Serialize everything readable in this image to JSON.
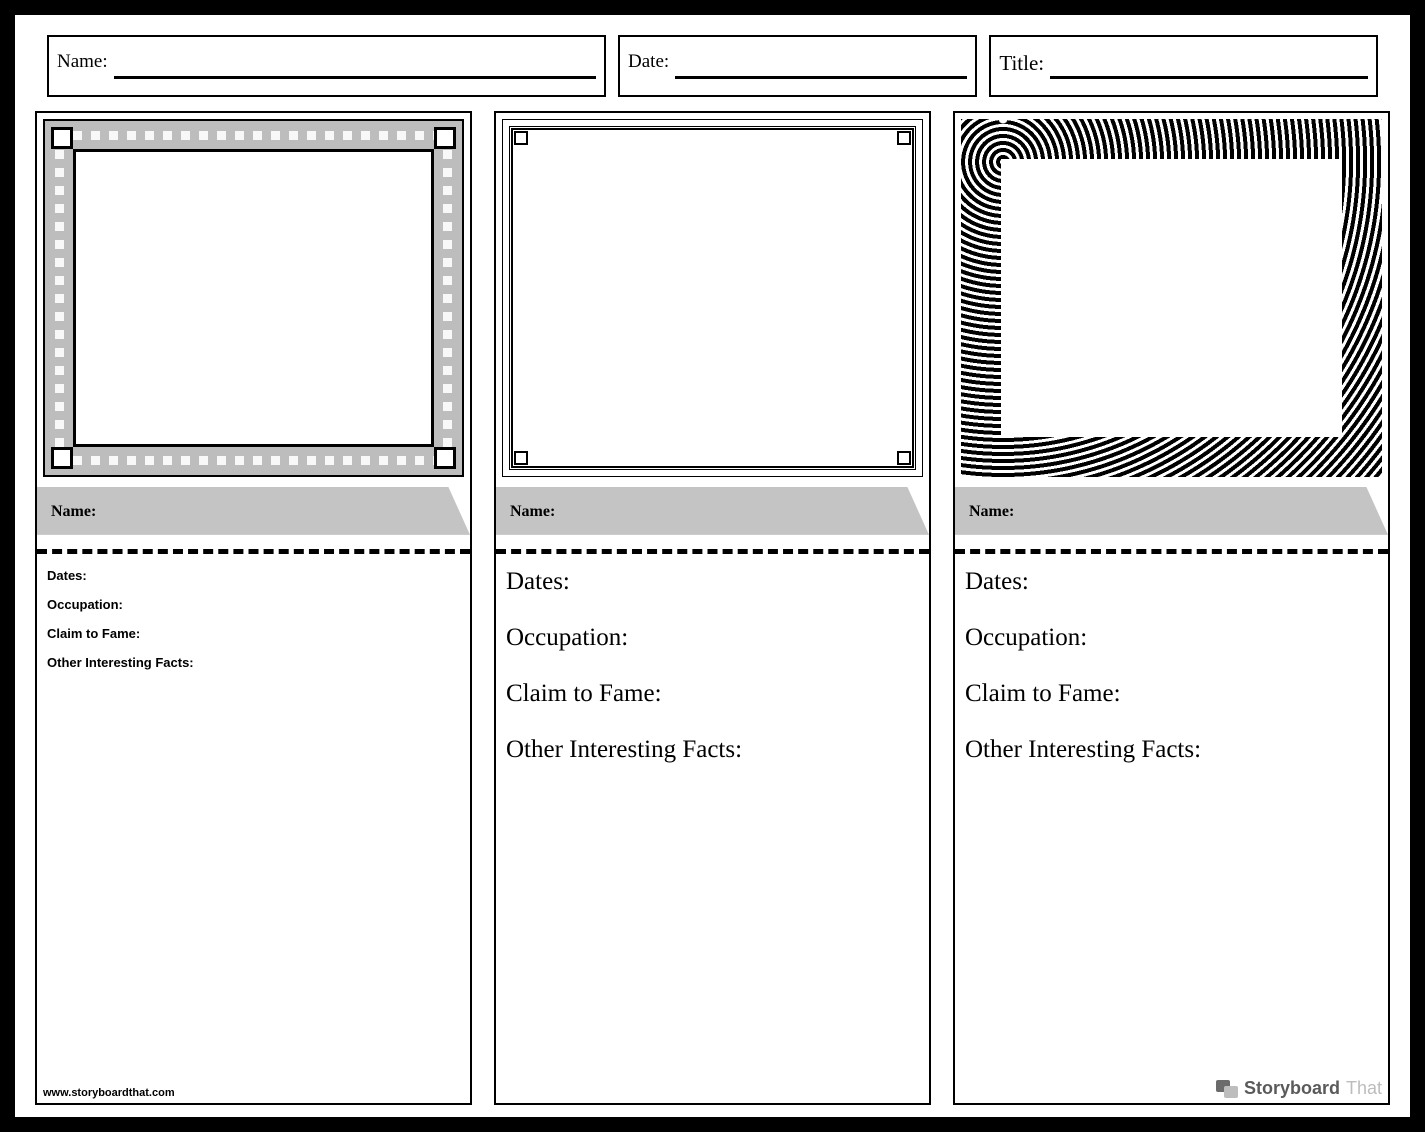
{
  "header": {
    "name_label": "Name:",
    "date_label": "Date:",
    "title_label": "Title:"
  },
  "panels": [
    {
      "name_label": "Name:",
      "facts": {
        "dates": "Dates:",
        "occupation": "Occupation:",
        "claim": "Claim to Fame:",
        "other": "Other Interesting Facts:"
      },
      "facts_size": "small"
    },
    {
      "name_label": "Name:",
      "facts": {
        "dates": "Dates:",
        "occupation": "Occupation:",
        "claim": "Claim to Fame:",
        "other": "Other Interesting Facts:"
      },
      "facts_size": "big"
    },
    {
      "name_label": "Name:",
      "facts": {
        "dates": "Dates:",
        "occupation": "Occupation:",
        "claim": "Claim to Fame:",
        "other": "Other Interesting Facts:"
      },
      "facts_size": "big"
    }
  ],
  "footer": {
    "url": "www.storyboardthat.com",
    "brand1": "Storyboard",
    "brand2": "That"
  }
}
